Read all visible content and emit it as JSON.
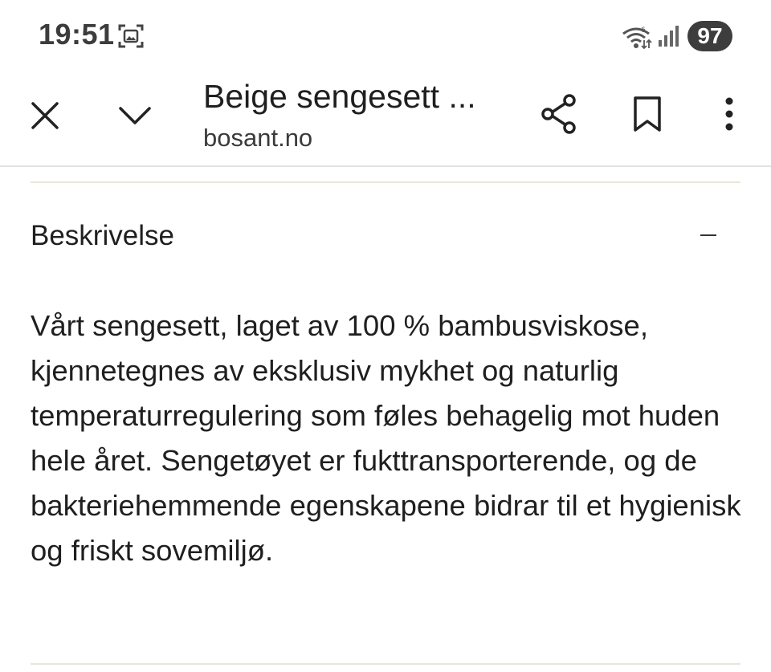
{
  "status_bar": {
    "time": "19:51",
    "battery": "97",
    "icons": [
      "screenshot-icon",
      "wifi-icon",
      "signal-icon"
    ]
  },
  "toolbar": {
    "title": "Beige sengesett ...",
    "domain": "bosant.no",
    "icons": [
      "close-icon",
      "chevron-down-icon",
      "share-icon",
      "bookmark-icon",
      "more-vert-icon"
    ]
  },
  "section": {
    "title": "Beskrivelse",
    "toggle_icon": "minus-icon",
    "description": "Vårt sengesett, laget av 100 % bambusviskose, kjennetegnes av eksklusiv mykhet og naturlig temperaturregulering som føles behagelig mot huden hele året. Sengetøyet er fukttransporterende, og de bakteriehemmende egenskapene bidrar til et hygienisk og friskt sovemiljø."
  },
  "colors": {
    "text": "#1f1f1f",
    "divider": "#e9e6d8",
    "battery_bg": "#3d3d3d"
  }
}
